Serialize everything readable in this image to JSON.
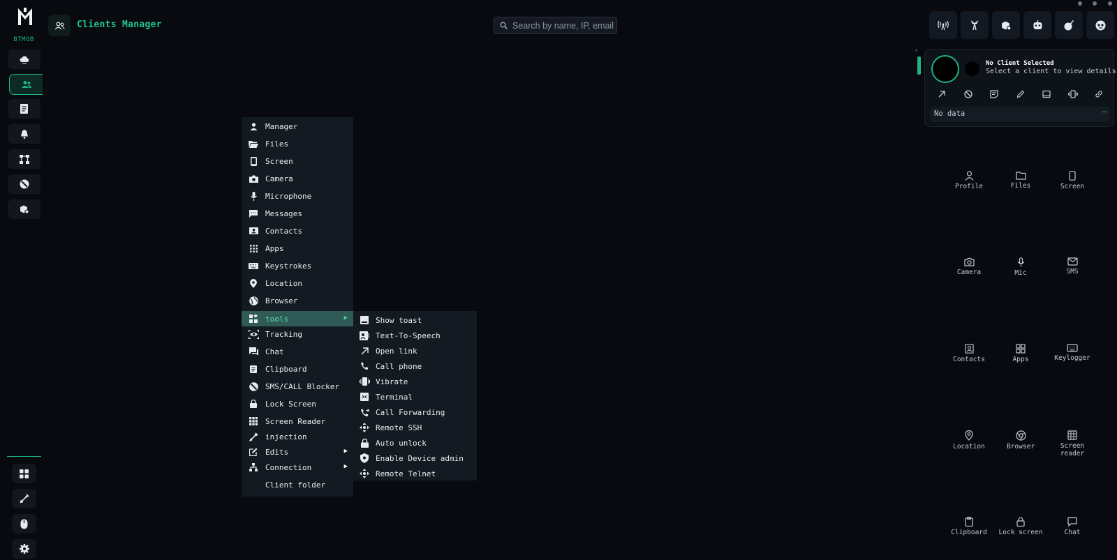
{
  "brand": "BTMOB",
  "header": {
    "title": "Clients Manager"
  },
  "search": {
    "placeholder": "Search by name, IP, email"
  },
  "top_buttons": [
    "antenna-icon",
    "tower-icon",
    "package-gear-icon",
    "robot-icon",
    "bomb-icon",
    "skull-icon"
  ],
  "sidebar": {
    "items": [
      "cloud-icon",
      "users-icon",
      "document-icon",
      "bell-icon",
      "network-icon",
      "block-icon",
      "package-gear-icon"
    ],
    "active_index": 1,
    "bottom": [
      "dashboard-icon",
      "syringe-icon",
      "mouse-icon",
      "gear-icon"
    ]
  },
  "client": {
    "name": "No Client Selected",
    "subtitle": "Select a client to view details",
    "no_data": "No data",
    "actions": [
      "open-link-icon",
      "block-icon",
      "note-icon",
      "pencil-icon",
      "tablet-icon",
      "vibrate-icon",
      "link-icon"
    ]
  },
  "quick": [
    {
      "label": "Profile",
      "icon": "person-icon"
    },
    {
      "label": "Files",
      "icon": "folder-icon"
    },
    {
      "label": "Screen",
      "icon": "phone-icon"
    },
    {
      "label": "Camera",
      "icon": "camera-icon"
    },
    {
      "label": "Mic",
      "icon": "mic-icon"
    },
    {
      "label": "SMS",
      "icon": "mail-icon"
    },
    {
      "label": "Contacts",
      "icon": "contacts-icon"
    },
    {
      "label": "Apps",
      "icon": "grid-icon"
    },
    {
      "label": "Keylogger",
      "icon": "keyboard-icon"
    },
    {
      "label": "Location",
      "icon": "pin-icon"
    },
    {
      "label": "Browser",
      "icon": "chrome-icon"
    },
    {
      "label": "Screen reader",
      "icon": "table-icon"
    },
    {
      "label": "Clipboard",
      "icon": "clipboard-icon"
    },
    {
      "label": "Lock screen",
      "icon": "lock-icon"
    },
    {
      "label": "Chat",
      "icon": "chat-icon"
    }
  ],
  "menu": {
    "items": [
      {
        "label": "Manager",
        "icon": "person-icon"
      },
      {
        "label": "Files",
        "icon": "folder-open-icon"
      },
      {
        "label": "Screen",
        "icon": "phone-icon"
      },
      {
        "label": "Camera",
        "icon": "camera-icon"
      },
      {
        "label": "Microphone",
        "icon": "mic-icon"
      },
      {
        "label": "Messages",
        "icon": "message-icon"
      },
      {
        "label": "Contacts",
        "icon": "contacts-icon"
      },
      {
        "label": "Apps",
        "icon": "apps-icon"
      },
      {
        "label": "Keystrokes",
        "icon": "keyboard-icon"
      },
      {
        "label": "Location",
        "icon": "pin-icon"
      },
      {
        "label": "Browser",
        "icon": "globe-icon"
      },
      {
        "label": "tools",
        "icon": "widgets-icon",
        "submenu": true,
        "highlighted": true
      },
      {
        "label": "Tracking",
        "icon": "eye-icon"
      },
      {
        "label": "Chat",
        "icon": "chat-icon"
      },
      {
        "label": "Clipboard",
        "icon": "clipboard-icon"
      },
      {
        "label": "SMS/CALL Blocker",
        "icon": "block-icon"
      },
      {
        "label": "Lock Screen",
        "icon": "lock-icon"
      },
      {
        "label": "Screen Reader",
        "icon": "table-icon"
      },
      {
        "label": "injection",
        "icon": "syringe-icon"
      },
      {
        "label": "Edits",
        "icon": "edit-icon",
        "submenu": true
      },
      {
        "label": "Connection",
        "icon": "hierarchy-icon",
        "submenu": true
      },
      {
        "label": "Client folder",
        "icon": ""
      }
    ],
    "tools_submenu": [
      {
        "label": "Show toast",
        "icon": "toast-icon"
      },
      {
        "label": "Text-To-Speech",
        "icon": "speech-icon"
      },
      {
        "label": "Open link",
        "icon": "open-link-icon"
      },
      {
        "label": "Call phone",
        "icon": "phone-call-icon"
      },
      {
        "label": "Vibrate",
        "icon": "vibrate-icon"
      },
      {
        "label": "Terminal",
        "icon": "terminal-icon"
      },
      {
        "label": "Call Forwarding",
        "icon": "call-forward-icon"
      },
      {
        "label": "Remote SSH",
        "icon": "move-icon"
      },
      {
        "label": "Auto unlock",
        "icon": "lock-icon"
      },
      {
        "label": "Enable Device admin",
        "icon": "shield-icon"
      },
      {
        "label": "Remote Telnet",
        "icon": "move-icon"
      }
    ]
  },
  "colors": {
    "accent": "#1db584",
    "background": "#080a0f",
    "menu_bg": "#131a22",
    "highlight": "#2f5a56"
  }
}
